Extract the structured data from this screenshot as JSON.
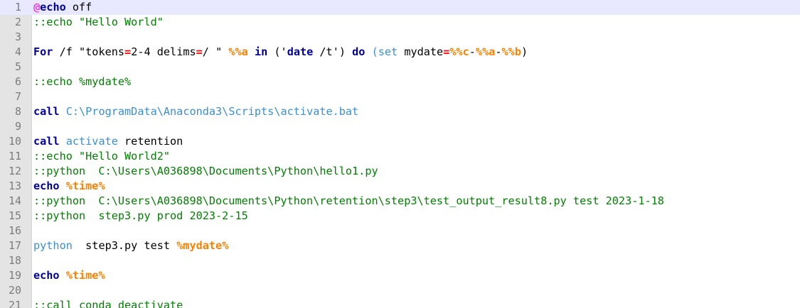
{
  "editor": {
    "current_line": 1,
    "lines": [
      {
        "n": "1",
        "tokens": [
          {
            "t": "@",
            "c": "at"
          },
          {
            "t": "echo",
            "c": "kw"
          },
          {
            "t": " off",
            "c": "txt"
          }
        ]
      },
      {
        "n": "2",
        "tokens": [
          {
            "t": "::echo \"Hello World\"",
            "c": "cmt"
          }
        ]
      },
      {
        "n": "3",
        "tokens": []
      },
      {
        "n": "4",
        "tokens": [
          {
            "t": "For",
            "c": "kw"
          },
          {
            "t": " /f \"tokens",
            "c": "txt"
          },
          {
            "t": "=",
            "c": "op"
          },
          {
            "t": "2-4 delims",
            "c": "txt"
          },
          {
            "t": "=",
            "c": "op"
          },
          {
            "t": "/ \" ",
            "c": "txt"
          },
          {
            "t": "%%a",
            "c": "var"
          },
          {
            "t": " ",
            "c": "txt"
          },
          {
            "t": "in",
            "c": "kw"
          },
          {
            "t": " ('",
            "c": "txt"
          },
          {
            "t": "date",
            "c": "kw"
          },
          {
            "t": " /t') ",
            "c": "txt"
          },
          {
            "t": "do",
            "c": "kw"
          },
          {
            "t": " ",
            "c": "txt"
          },
          {
            "t": "(set",
            "c": "path"
          },
          {
            "t": " mydate",
            "c": "txt"
          },
          {
            "t": "=",
            "c": "op"
          },
          {
            "t": "%%c",
            "c": "var"
          },
          {
            "t": "-",
            "c": "txt"
          },
          {
            "t": "%%a",
            "c": "var"
          },
          {
            "t": "-",
            "c": "txt"
          },
          {
            "t": "%%b",
            "c": "var"
          },
          {
            "t": ")",
            "c": "txt"
          }
        ]
      },
      {
        "n": "5",
        "tokens": []
      },
      {
        "n": "6",
        "tokens": [
          {
            "t": "::echo %mydate%",
            "c": "cmt"
          }
        ]
      },
      {
        "n": "7",
        "tokens": []
      },
      {
        "n": "8",
        "tokens": [
          {
            "t": "call",
            "c": "kw"
          },
          {
            "t": " ",
            "c": "txt"
          },
          {
            "t": "C:\\ProgramData\\Anaconda3\\Scripts\\activate.bat",
            "c": "path"
          }
        ]
      },
      {
        "n": "9",
        "tokens": []
      },
      {
        "n": "10",
        "tokens": [
          {
            "t": "call",
            "c": "kw"
          },
          {
            "t": " ",
            "c": "txt"
          },
          {
            "t": "activate",
            "c": "path"
          },
          {
            "t": " retention",
            "c": "txt"
          }
        ]
      },
      {
        "n": "11",
        "tokens": [
          {
            "t": "::echo \"Hello World2\"",
            "c": "cmt"
          }
        ]
      },
      {
        "n": "12",
        "tokens": [
          {
            "t": "::python  C:\\Users\\A036898\\Documents\\Python\\hello1.py",
            "c": "cmt"
          }
        ]
      },
      {
        "n": "13",
        "tokens": [
          {
            "t": "echo",
            "c": "kw"
          },
          {
            "t": " ",
            "c": "txt"
          },
          {
            "t": "%time%",
            "c": "var"
          }
        ]
      },
      {
        "n": "14",
        "tokens": [
          {
            "t": "::python  C:\\Users\\A036898\\Documents\\Python\\retention\\step3\\test_output_result8.py test 2023-1-18",
            "c": "cmt"
          }
        ]
      },
      {
        "n": "15",
        "tokens": [
          {
            "t": "::python  step3.py prod 2023-2-15",
            "c": "cmt"
          }
        ]
      },
      {
        "n": "16",
        "tokens": []
      },
      {
        "n": "17",
        "tokens": [
          {
            "t": "python",
            "c": "path"
          },
          {
            "t": "  step3.py test ",
            "c": "txt"
          },
          {
            "t": "%mydate%",
            "c": "var"
          }
        ]
      },
      {
        "n": "18",
        "tokens": []
      },
      {
        "n": "19",
        "tokens": [
          {
            "t": "echo",
            "c": "kw"
          },
          {
            "t": " ",
            "c": "txt"
          },
          {
            "t": "%time%",
            "c": "var"
          }
        ]
      },
      {
        "n": "20",
        "tokens": []
      },
      {
        "n": "21",
        "tokens": [
          {
            "t": "::call conda deactivate",
            "c": "cmt"
          }
        ]
      }
    ]
  }
}
